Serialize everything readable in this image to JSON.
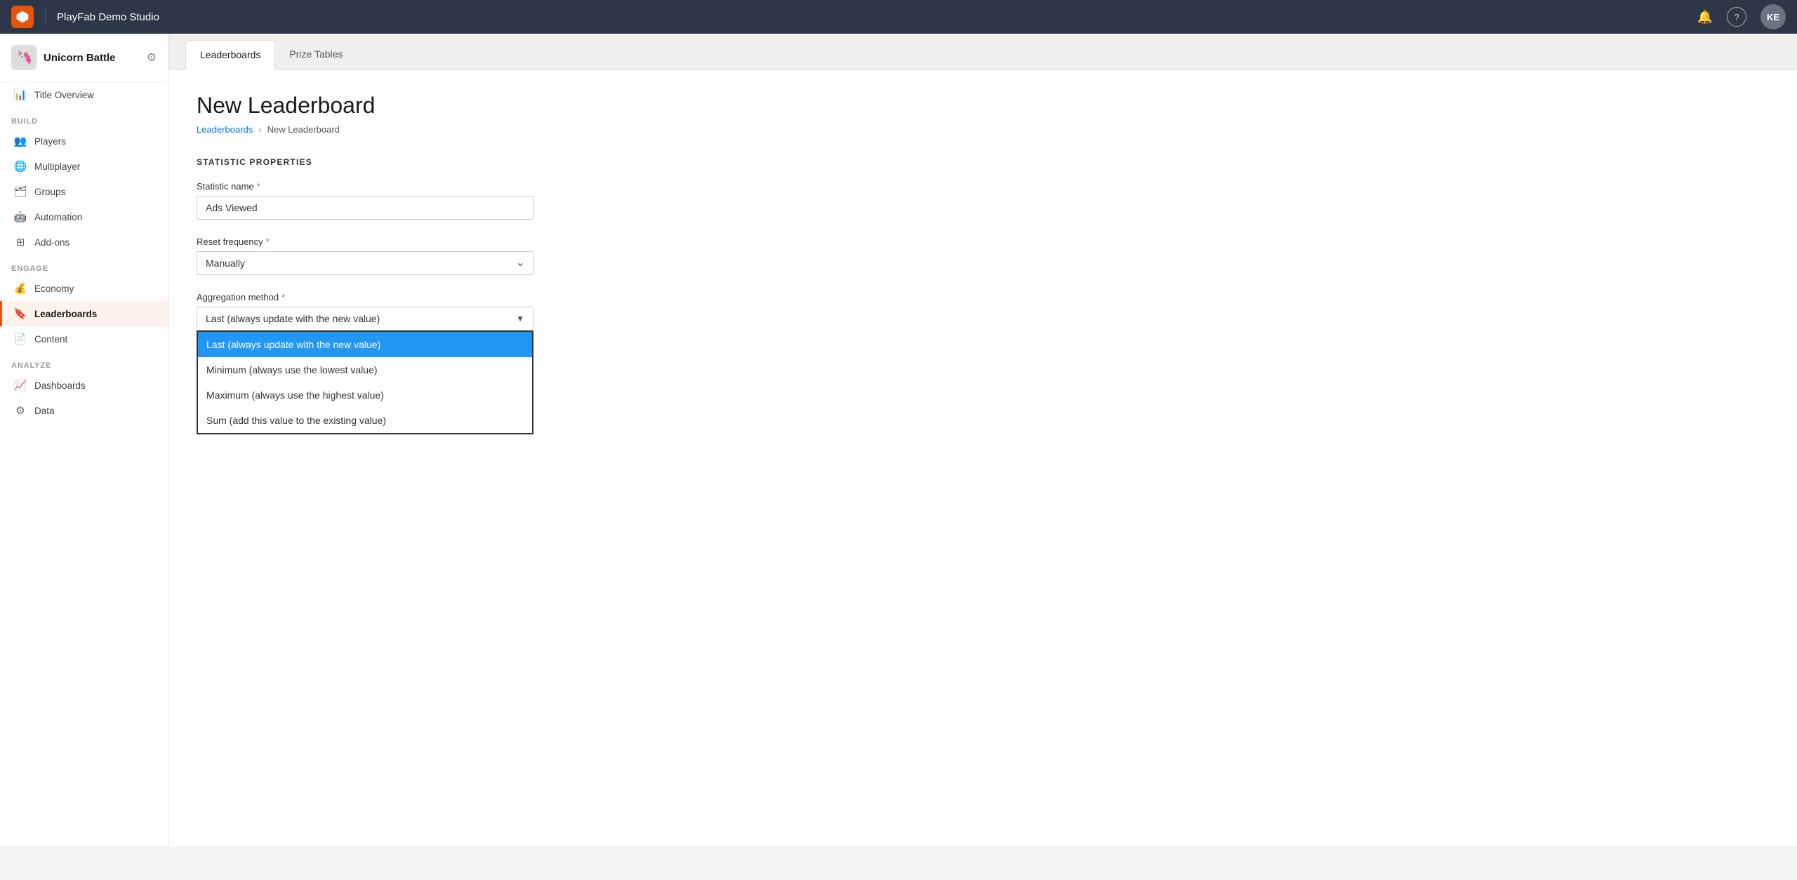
{
  "topbar": {
    "title": "PlayFab Demo Studio",
    "avatar_initials": "KE"
  },
  "sidebar": {
    "game_title": "Unicorn Battle",
    "title_overview_label": "Title Overview",
    "build_section": "BUILD",
    "nav_build": [
      {
        "label": "Players",
        "icon": "👥",
        "id": "players"
      },
      {
        "label": "Multiplayer",
        "icon": "🌐",
        "id": "multiplayer"
      },
      {
        "label": "Groups",
        "icon": "🗂",
        "id": "groups"
      },
      {
        "label": "Automation",
        "icon": "🤖",
        "id": "automation"
      },
      {
        "label": "Add-ons",
        "icon": "⊞",
        "id": "addons"
      }
    ],
    "engage_section": "ENGAGE",
    "nav_engage": [
      {
        "label": "Economy",
        "icon": "💰",
        "id": "economy"
      },
      {
        "label": "Leaderboards",
        "icon": "🔖",
        "id": "leaderboards",
        "active": true
      },
      {
        "label": "Content",
        "icon": "📄",
        "id": "content"
      }
    ],
    "analyze_section": "ANALYZE",
    "nav_analyze": [
      {
        "label": "Dashboards",
        "icon": "📊",
        "id": "dashboards"
      },
      {
        "label": "Data",
        "icon": "⚙",
        "id": "data"
      }
    ]
  },
  "tabs": [
    {
      "label": "Leaderboards",
      "active": true
    },
    {
      "label": "Prize Tables",
      "active": false
    }
  ],
  "page": {
    "title": "New Leaderboard",
    "breadcrumb_link": "Leaderboards",
    "breadcrumb_sep": ">",
    "breadcrumb_current": "New Leaderboard",
    "section_title": "STATISTIC PROPERTIES",
    "statistic_name_label": "Statistic name",
    "statistic_name_value": "Ads Viewed",
    "reset_frequency_label": "Reset frequency",
    "reset_frequency_value": "Manually",
    "aggregation_method_label": "Aggregation method",
    "dropdown_options": [
      {
        "label": "Last (always update with the new value)",
        "selected": true
      },
      {
        "label": "Minimum (always use the lowest value)",
        "selected": false
      },
      {
        "label": "Maximum (always use the highest value)",
        "selected": false
      },
      {
        "label": "Sum (add this value to the existing value)",
        "selected": false
      }
    ]
  }
}
